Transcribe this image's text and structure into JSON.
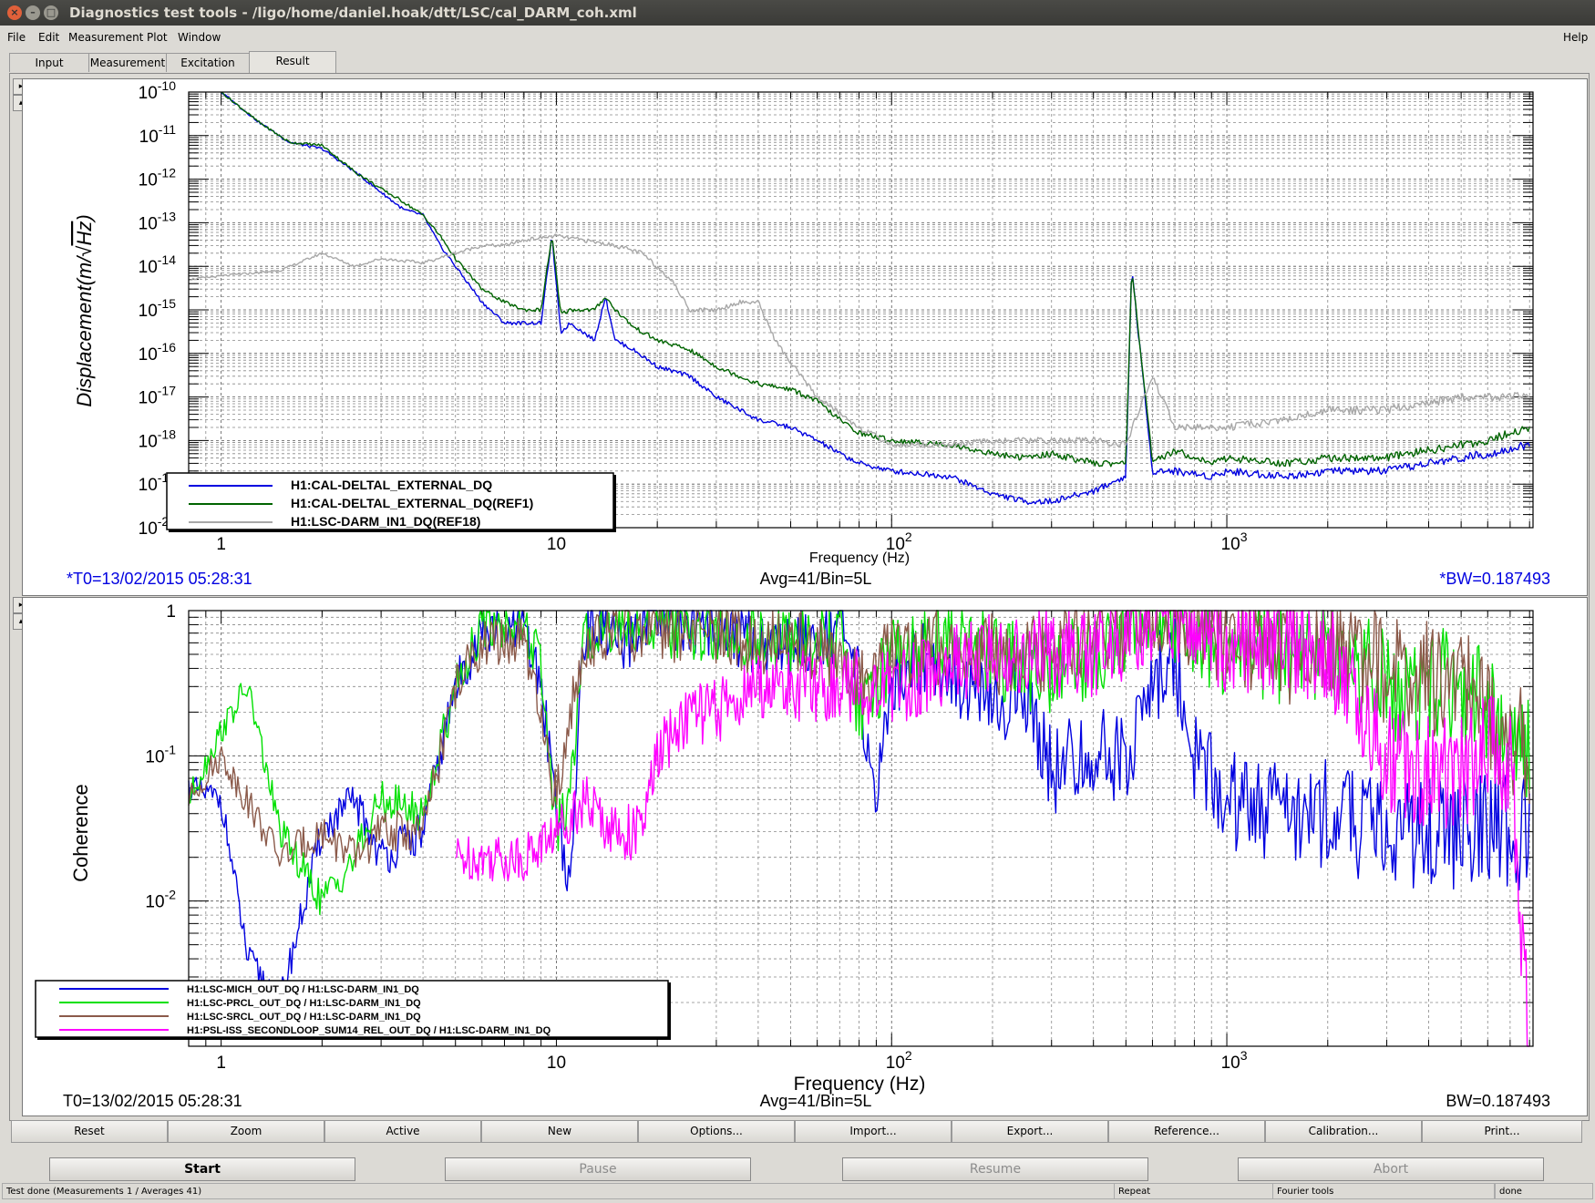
{
  "window": {
    "title": "Diagnostics test tools - /ligo/home/daniel.hoak/dtt/LSC/cal_DARM_coh.xml"
  },
  "menu": [
    "File",
    "Edit",
    "Measurement",
    "Plot",
    "Window"
  ],
  "help_label": "Help",
  "tabs": [
    "Input",
    "Measurement",
    "Excitation",
    "Result"
  ],
  "active_tab": "Result",
  "plot_top": {
    "ylabel_text": "Displacement",
    "ylabel_unit": "(m/",
    "ylabel_unit_rad": "Hz",
    "ylabel_unit_close": ")",
    "xlabel": "Frequency (Hz)",
    "footer_left": "*T0=13/02/2015 05:28:31",
    "footer_mid": "Avg=41/Bin=5L",
    "footer_right": "*BW=0.187493",
    "legend": [
      {
        "label": "H1:CAL-DELTAL_EXTERNAL_DQ",
        "color": "#0000e0"
      },
      {
        "label": "H1:CAL-DELTAL_EXTERNAL_DQ(REF1)",
        "color": "#006400"
      },
      {
        "label": "H1:LSC-DARM_IN1_DQ(REF18)",
        "color": "#a8a8a8"
      }
    ]
  },
  "plot_bottom": {
    "ylabel": "Coherence",
    "xlabel": "Frequency (Hz)",
    "footer_left": "T0=13/02/2015 05:28:31",
    "footer_mid": "Avg=41/Bin=5L",
    "footer_right": "BW=0.187493",
    "legend": [
      {
        "label": "H1:LSC-MICH_OUT_DQ / H1:LSC-DARM_IN1_DQ",
        "color": "#0000e0"
      },
      {
        "label": "H1:LSC-PRCL_OUT_DQ / H1:LSC-DARM_IN1_DQ",
        "color": "#00e000"
      },
      {
        "label": "H1:LSC-SRCL_OUT_DQ / H1:LSC-DARM_IN1_DQ",
        "color": "#8b5a4a"
      },
      {
        "label": "H1:PSL-ISS_SECONDLOOP_SUM14_REL_OUT_DQ / H1:LSC-DARM_IN1_DQ",
        "color": "#ff00ff"
      }
    ]
  },
  "toolbar": [
    "Reset",
    "Zoom",
    "Active",
    "New",
    "Options...",
    "Import...",
    "Export...",
    "Reference...",
    "Calibration...",
    "Print..."
  ],
  "controls": {
    "start": "Start",
    "pause": "Pause",
    "resume": "Resume",
    "abort": "Abort"
  },
  "status": {
    "main": "Test done (Measurements 1 / Averages 41)",
    "repeat": "Repeat",
    "tools": "Fourier tools",
    "state": "done"
  },
  "chart_data": [
    {
      "type": "line",
      "title": "",
      "xlabel": "Frequency (Hz)",
      "ylabel": "Displacement (m/√Hz)",
      "xscale": "log",
      "yscale": "log",
      "xlim": [
        0.8,
        8192
      ],
      "ylim": [
        1e-20,
        1e-10
      ],
      "x_ticks": [
        "1",
        "10",
        "10^2",
        "10^3"
      ],
      "y_ticks": [
        "10^-10",
        "10^-11",
        "10^-12",
        "10^-13",
        "10^-14",
        "10^-15",
        "10^-16",
        "10^-17",
        "10^-18",
        "10^-19",
        "10^-20"
      ],
      "grid": true,
      "legend_position": "bottom-left",
      "series": [
        {
          "name": "H1:CAL-DELTAL_EXTERNAL_DQ",
          "color": "#0000e0",
          "x": [
            1.0,
            1.3,
            1.6,
            2.0,
            2.5,
            3.0,
            3.5,
            4.0,
            4.5,
            5.0,
            6.0,
            7.0,
            8.0,
            9.0,
            9.7,
            10.3,
            11,
            13,
            14,
            15,
            17,
            20,
            25,
            30,
            40,
            50,
            60,
            70,
            80,
            100,
            150,
            200,
            250,
            300,
            400,
            500,
            520,
            600,
            700,
            900,
            1000,
            1500,
            2000,
            3000,
            4000,
            6000,
            8000
          ],
          "y": [
            1e-10,
            2e-11,
            7e-12,
            5e-12,
            1.5e-12,
            5e-13,
            2e-13,
            1.5e-13,
            3e-14,
            1e-14,
            1.5e-15,
            5e-16,
            5e-16,
            5e-16,
            5e-14,
            3e-16,
            5e-16,
            2e-16,
            2e-15,
            2e-16,
            1.2e-16,
            5e-17,
            3e-17,
            1e-17,
            3e-18,
            2e-18,
            1e-18,
            5e-19,
            3e-19,
            2e-19,
            1.5e-19,
            6e-20,
            4e-20,
            4e-20,
            7e-20,
            1.5e-19,
            1e-14,
            2e-19,
            2e-19,
            1.5e-19,
            2e-19,
            1.5e-19,
            2e-19,
            2e-19,
            3e-19,
            5e-19,
            8e-19
          ]
        },
        {
          "name": "H1:CAL-DELTAL_EXTERNAL_DQ(REF1)",
          "color": "#006400",
          "x": [
            1.0,
            1.3,
            1.6,
            2.0,
            2.5,
            3.0,
            3.5,
            4.0,
            4.5,
            5.0,
            6.0,
            7.0,
            8.0,
            9.0,
            9.7,
            10.3,
            11,
            13,
            14,
            15,
            17,
            20,
            25,
            30,
            40,
            50,
            60,
            70,
            80,
            100,
            150,
            200,
            250,
            300,
            400,
            500,
            520,
            600,
            700,
            900,
            1000,
            1500,
            2000,
            3000,
            4000,
            6000,
            8000
          ],
          "y": [
            1e-10,
            2e-11,
            7e-12,
            6e-12,
            1.5e-12,
            6e-13,
            3e-13,
            1.5e-13,
            5e-14,
            1.5e-14,
            3e-15,
            1.5e-15,
            1e-15,
            1e-15,
            5e-14,
            8e-16,
            1e-15,
            1e-15,
            2e-15,
            1e-15,
            4e-16,
            2e-16,
            1.2e-16,
            5e-17,
            2e-17,
            1.5e-17,
            8e-18,
            3e-18,
            1.5e-18,
            1e-18,
            8e-19,
            5e-19,
            4e-19,
            5e-19,
            3e-19,
            3e-19,
            1e-14,
            3e-19,
            6e-19,
            3e-19,
            4e-19,
            3e-19,
            4e-19,
            4e-19,
            6e-19,
            1e-18,
            2e-18
          ]
        },
        {
          "name": "H1:LSC-DARM_IN1_DQ(REF18)",
          "color": "#a8a8a8",
          "x": [
            0.8,
            1.0,
            1.5,
            2.0,
            2.5,
            3.0,
            4.0,
            5.0,
            6.0,
            7.0,
            8.0,
            10,
            12,
            15,
            18,
            22,
            25,
            30,
            35,
            40,
            45,
            50,
            60,
            80,
            100,
            150,
            200,
            300,
            400,
            500,
            600,
            700,
            1000,
            1500,
            2000,
            3000,
            5000,
            8000
          ],
          "y": [
            5e-15,
            6e-15,
            8e-15,
            2e-14,
            1e-14,
            1.5e-14,
            1.2e-14,
            2e-14,
            3e-14,
            3e-14,
            4e-14,
            5e-14,
            4e-14,
            3e-14,
            2e-14,
            5e-15,
            1e-15,
            1e-15,
            1.5e-15,
            1.5e-15,
            2e-16,
            6e-17,
            1e-17,
            2e-18,
            8e-19,
            8e-19,
            1e-18,
            1e-18,
            1e-18,
            8e-19,
            3e-17,
            2e-18,
            2e-18,
            3e-18,
            5e-18,
            5e-18,
            1e-17,
            1e-17
          ]
        }
      ]
    },
    {
      "type": "line",
      "title": "",
      "xlabel": "Frequency (Hz)",
      "ylabel": "Coherence",
      "xscale": "log",
      "yscale": "log",
      "xlim": [
        0.8,
        8192
      ],
      "ylim": [
        0.001,
        1
      ],
      "x_ticks": [
        "1",
        "10",
        "10^2",
        "10^3"
      ],
      "y_ticks": [
        "1",
        "10^-1",
        "10^-2"
      ],
      "grid": true,
      "legend_position": "bottom-left",
      "series": [
        {
          "name": "H1:LSC-MICH_OUT_DQ / H1:LSC-DARM_IN1_DQ",
          "color": "#0000e0",
          "x": [
            0.8,
            1.0,
            1.2,
            1.5,
            2.0,
            2.5,
            3.0,
            4.0,
            5.0,
            6.0,
            8.0,
            9.0,
            10,
            11,
            12,
            14,
            16,
            18,
            20,
            25,
            30,
            40,
            50,
            60,
            70,
            80,
            90,
            100,
            120,
            150,
            200,
            250,
            300,
            400,
            500,
            600,
            700,
            800,
            1000,
            1500,
            2000,
            3000,
            5000,
            8000
          ],
          "y": [
            0.06,
            0.05,
            0.004,
            0.002,
            0.03,
            0.05,
            0.02,
            0.03,
            0.3,
            0.7,
            0.7,
            0.3,
            0.05,
            0.01,
            0.7,
            0.8,
            0.5,
            0.8,
            0.8,
            0.8,
            0.8,
            0.6,
            0.6,
            0.7,
            0.8,
            0.3,
            0.05,
            0.3,
            0.5,
            0.4,
            0.2,
            0.3,
            0.08,
            0.1,
            0.1,
            0.3,
            0.5,
            0.1,
            0.05,
            0.04,
            0.04,
            0.03,
            0.03,
            0.03
          ]
        },
        {
          "name": "H1:LSC-PRCL_OUT_DQ / H1:LSC-DARM_IN1_DQ",
          "color": "#00e000",
          "x": [
            0.8,
            1.0,
            1.2,
            1.5,
            2.0,
            2.5,
            3.0,
            4.0,
            5.0,
            6.0,
            8.0,
            9.0,
            10,
            11,
            12,
            14,
            16,
            18,
            20,
            25,
            30,
            40,
            50,
            60,
            70,
            80,
            90,
            100,
            120,
            150,
            200,
            250,
            300,
            400,
            500,
            600,
            700,
            800,
            1000,
            1500,
            2000,
            3000,
            5000,
            8000
          ],
          "y": [
            0.05,
            0.15,
            0.3,
            0.03,
            0.01,
            0.02,
            0.05,
            0.04,
            0.3,
            0.8,
            0.8,
            0.4,
            0.03,
            0.05,
            0.6,
            0.8,
            0.8,
            0.8,
            0.8,
            0.7,
            0.7,
            0.6,
            0.6,
            0.6,
            0.7,
            0.2,
            0.3,
            0.5,
            0.6,
            0.7,
            0.5,
            0.4,
            0.4,
            0.5,
            0.8,
            0.9,
            0.95,
            0.7,
            0.5,
            0.5,
            0.6,
            0.3,
            0.3,
            0.1
          ]
        },
        {
          "name": "H1:LSC-SRCL_OUT_DQ / H1:LSC-DARM_IN1_DQ",
          "color": "#8b5a4a",
          "x": [
            0.8,
            1.0,
            1.5,
            2.0,
            2.5,
            3.0,
            4.0,
            5.0,
            6.0,
            8.0,
            10,
            12,
            16,
            20,
            30,
            40,
            60,
            80,
            100,
            150,
            200,
            300,
            500,
            700,
            1000,
            1500,
            2000,
            3000,
            5000,
            8000
          ],
          "y": [
            0.05,
            0.1,
            0.02,
            0.03,
            0.02,
            0.03,
            0.03,
            0.3,
            0.6,
            0.6,
            0.05,
            0.6,
            0.7,
            0.7,
            0.7,
            0.6,
            0.6,
            0.3,
            0.5,
            0.6,
            0.5,
            0.5,
            0.8,
            0.9,
            0.7,
            0.5,
            0.6,
            0.4,
            0.3,
            0.1
          ]
        },
        {
          "name": "H1:PSL-ISS_SECONDLOOP_SUM14_REL_OUT_DQ / H1:LSC-DARM_IN1_DQ",
          "color": "#ff00ff",
          "x": [
            5,
            8,
            10,
            12,
            15,
            18,
            20,
            25,
            30,
            40,
            50,
            60,
            70,
            100,
            200,
            300,
            400,
            500,
            600,
            700,
            800,
            1000,
            1500,
            2000,
            3000,
            4000,
            5000,
            6000,
            7000,
            8000
          ],
          "y": [
            0.02,
            0.02,
            0.03,
            0.05,
            0.03,
            0.03,
            0.1,
            0.2,
            0.2,
            0.3,
            0.3,
            0.3,
            0.3,
            0.3,
            0.5,
            0.5,
            0.5,
            0.7,
            0.9,
            0.95,
            0.8,
            0.6,
            0.6,
            0.5,
            0.1,
            0.08,
            0.08,
            0.1,
            0.1,
            0.001
          ]
        }
      ]
    }
  ]
}
